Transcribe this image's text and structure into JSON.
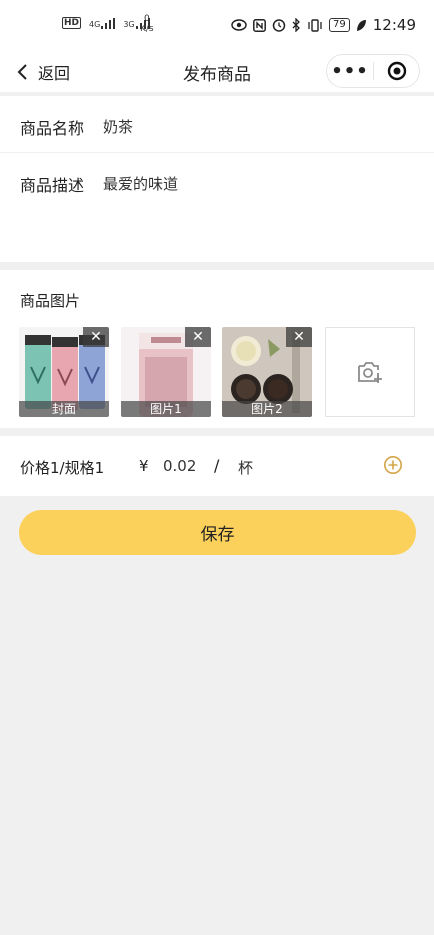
{
  "status_bar": {
    "network_left": "HD",
    "sig1": "4G",
    "sig2": "3G",
    "speed_value": "0",
    "speed_unit": "K/s",
    "battery": "79",
    "time": "12:49"
  },
  "nav": {
    "back_label": "返回",
    "title": "发布商品",
    "more_icon": "more-dots-icon",
    "close_icon": "target-circle-icon"
  },
  "form": {
    "name_label": "商品名称",
    "name_value": "奶茶",
    "desc_label": "商品描述",
    "desc_value": "最爱的味道",
    "images_label": "商品图片",
    "images": [
      {
        "caption": "封面"
      },
      {
        "caption": "图片1"
      },
      {
        "caption": "图片2"
      }
    ],
    "price_label": "价格1/规格1",
    "currency": "¥",
    "price_value": "0.02",
    "slash": "/",
    "unit": "杯"
  },
  "save_label": "保存",
  "colors": {
    "accent": "#fbd15b",
    "add_icon": "#d4a547",
    "background": "#f0f0f0"
  }
}
